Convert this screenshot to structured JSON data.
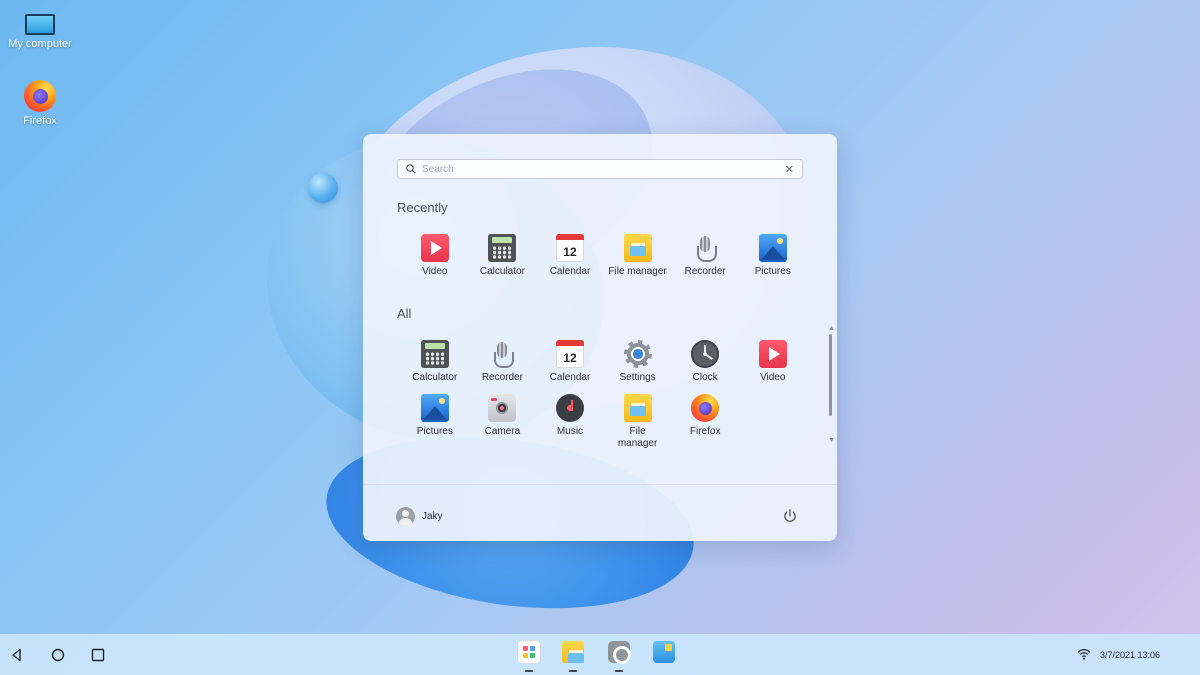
{
  "desktop": {
    "icons": [
      {
        "label": "My computer",
        "icon": "monitor-icon"
      },
      {
        "label": "Firefox",
        "icon": "firefox-icon"
      }
    ]
  },
  "start_menu": {
    "search": {
      "placeholder": "Search",
      "value": ""
    },
    "sections": {
      "recently": "Recently",
      "all": "All"
    },
    "recent_apps": [
      {
        "label": "Video",
        "icon": "video-icon"
      },
      {
        "label": "Calculator",
        "icon": "calculator-icon"
      },
      {
        "label": "Calendar",
        "icon": "calendar-icon",
        "badge": "12"
      },
      {
        "label": "File manager",
        "icon": "folder-icon"
      },
      {
        "label": "Recorder",
        "icon": "microphone-icon"
      },
      {
        "label": "Pictures",
        "icon": "pictures-icon"
      }
    ],
    "all_apps": [
      {
        "label": "Calculator",
        "icon": "calculator-icon"
      },
      {
        "label": "Recorder",
        "icon": "microphone-icon"
      },
      {
        "label": "Calendar",
        "icon": "calendar-icon",
        "badge": "12"
      },
      {
        "label": "Settings",
        "icon": "gear-icon"
      },
      {
        "label": "Clock",
        "icon": "clock-icon"
      },
      {
        "label": "Video",
        "icon": "video-icon"
      },
      {
        "label": "Pictures",
        "icon": "pictures-icon"
      },
      {
        "label": "Camera",
        "icon": "camera-icon"
      },
      {
        "label": "Music",
        "icon": "music-icon"
      },
      {
        "label": "File manager",
        "icon": "folder-icon"
      },
      {
        "label": "Firefox",
        "icon": "firefox-icon"
      }
    ],
    "user": {
      "name": "Jaky"
    }
  },
  "taskbar": {
    "nav": [
      "back-icon",
      "home-icon",
      "recent-apps-icon"
    ],
    "dock": [
      "launcher-icon",
      "file-manager-icon",
      "settings-icon",
      "app-store-icon"
    ],
    "datetime": "3/7/2021 13:06"
  },
  "colors": {
    "accent": "#2f7fe0",
    "panel_bg": "#ecf2fc",
    "taskbar_bg": "#cae6fc"
  }
}
